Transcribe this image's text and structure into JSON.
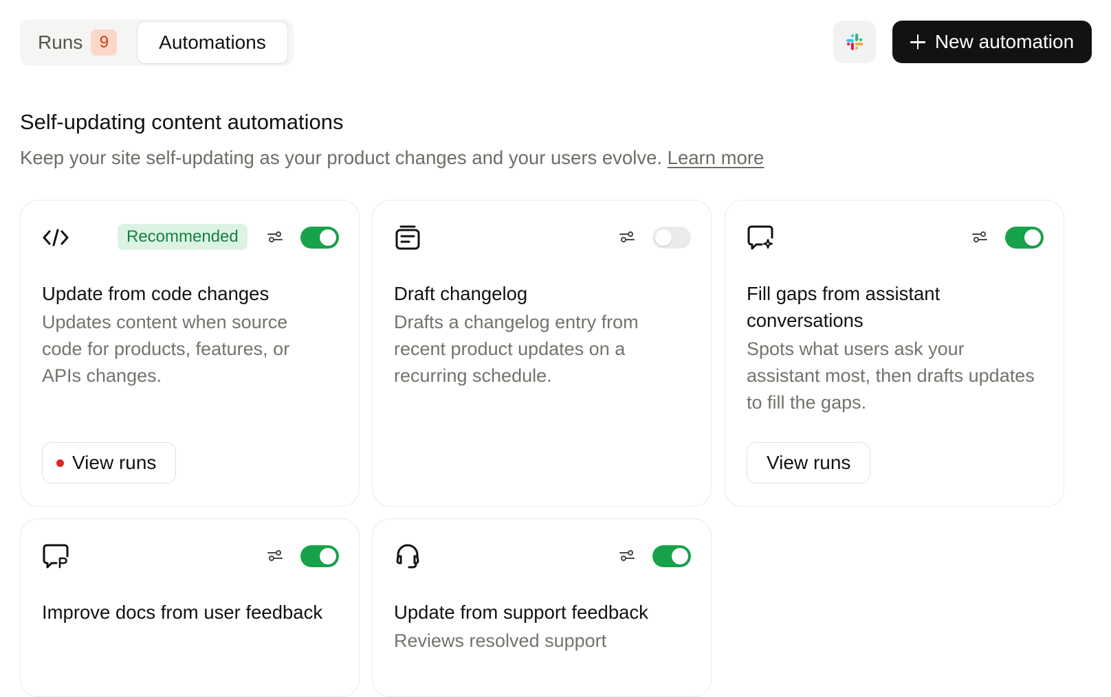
{
  "tabs": {
    "runs_label": "Runs",
    "runs_count": "9",
    "automations_label": "Automations"
  },
  "header": {
    "slack_icon": "slack-logo",
    "new_automation_label": "New automation"
  },
  "section": {
    "title": "Self-updating content automations",
    "description": "Keep your site self-updating as your product changes and your users evolve.",
    "learn_more": "Learn more"
  },
  "cards": [
    {
      "icon": "code-icon",
      "badge": "Recommended",
      "title": "Update from code changes",
      "description": "Updates content when source code for products, features, or APIs changes.",
      "enabled": true,
      "view_runs": "View runs",
      "has_alert": true
    },
    {
      "icon": "changelog-icon",
      "title": "Draft changelog",
      "description": "Drafts a changelog entry from recent product updates on a recurring schedule.",
      "enabled": false
    },
    {
      "icon": "assistant-chat-icon",
      "title": "Fill gaps from assistant conversations",
      "description": "Spots what users ask your assistant most, then drafts updates to fill the gaps.",
      "enabled": true,
      "view_runs": "View runs",
      "has_alert": false
    },
    {
      "icon": "feedback-chat-icon",
      "title": "Improve docs from user feedback",
      "description": "",
      "enabled": true
    },
    {
      "icon": "headset-icon",
      "title": "Update from support feedback",
      "description": "Reviews resolved support",
      "enabled": true
    }
  ],
  "colors": {
    "accent_green": "#16a34a",
    "badge_green_bg": "#dcf3e4",
    "runs_badge_bg": "#fbd7c7",
    "alert_red": "#dc2626",
    "primary_button": "#121212"
  }
}
